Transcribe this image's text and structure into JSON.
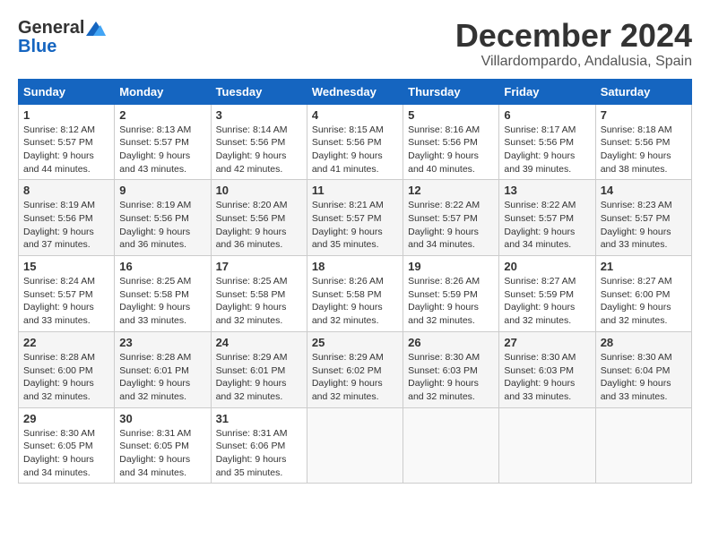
{
  "header": {
    "logo_general": "General",
    "logo_blue": "Blue",
    "month_title": "December 2024",
    "location": "Villardompardo, Andalusia, Spain"
  },
  "days_of_week": [
    "Sunday",
    "Monday",
    "Tuesday",
    "Wednesday",
    "Thursday",
    "Friday",
    "Saturday"
  ],
  "weeks": [
    [
      {
        "day": "1",
        "sunrise": "Sunrise: 8:12 AM",
        "sunset": "Sunset: 5:57 PM",
        "daylight": "Daylight: 9 hours and 44 minutes."
      },
      {
        "day": "2",
        "sunrise": "Sunrise: 8:13 AM",
        "sunset": "Sunset: 5:57 PM",
        "daylight": "Daylight: 9 hours and 43 minutes."
      },
      {
        "day": "3",
        "sunrise": "Sunrise: 8:14 AM",
        "sunset": "Sunset: 5:56 PM",
        "daylight": "Daylight: 9 hours and 42 minutes."
      },
      {
        "day": "4",
        "sunrise": "Sunrise: 8:15 AM",
        "sunset": "Sunset: 5:56 PM",
        "daylight": "Daylight: 9 hours and 41 minutes."
      },
      {
        "day": "5",
        "sunrise": "Sunrise: 8:16 AM",
        "sunset": "Sunset: 5:56 PM",
        "daylight": "Daylight: 9 hours and 40 minutes."
      },
      {
        "day": "6",
        "sunrise": "Sunrise: 8:17 AM",
        "sunset": "Sunset: 5:56 PM",
        "daylight": "Daylight: 9 hours and 39 minutes."
      },
      {
        "day": "7",
        "sunrise": "Sunrise: 8:18 AM",
        "sunset": "Sunset: 5:56 PM",
        "daylight": "Daylight: 9 hours and 38 minutes."
      }
    ],
    [
      {
        "day": "8",
        "sunrise": "Sunrise: 8:19 AM",
        "sunset": "Sunset: 5:56 PM",
        "daylight": "Daylight: 9 hours and 37 minutes."
      },
      {
        "day": "9",
        "sunrise": "Sunrise: 8:19 AM",
        "sunset": "Sunset: 5:56 PM",
        "daylight": "Daylight: 9 hours and 36 minutes."
      },
      {
        "day": "10",
        "sunrise": "Sunrise: 8:20 AM",
        "sunset": "Sunset: 5:56 PM",
        "daylight": "Daylight: 9 hours and 36 minutes."
      },
      {
        "day": "11",
        "sunrise": "Sunrise: 8:21 AM",
        "sunset": "Sunset: 5:57 PM",
        "daylight": "Daylight: 9 hours and 35 minutes."
      },
      {
        "day": "12",
        "sunrise": "Sunrise: 8:22 AM",
        "sunset": "Sunset: 5:57 PM",
        "daylight": "Daylight: 9 hours and 34 minutes."
      },
      {
        "day": "13",
        "sunrise": "Sunrise: 8:22 AM",
        "sunset": "Sunset: 5:57 PM",
        "daylight": "Daylight: 9 hours and 34 minutes."
      },
      {
        "day": "14",
        "sunrise": "Sunrise: 8:23 AM",
        "sunset": "Sunset: 5:57 PM",
        "daylight": "Daylight: 9 hours and 33 minutes."
      }
    ],
    [
      {
        "day": "15",
        "sunrise": "Sunrise: 8:24 AM",
        "sunset": "Sunset: 5:57 PM",
        "daylight": "Daylight: 9 hours and 33 minutes."
      },
      {
        "day": "16",
        "sunrise": "Sunrise: 8:25 AM",
        "sunset": "Sunset: 5:58 PM",
        "daylight": "Daylight: 9 hours and 33 minutes."
      },
      {
        "day": "17",
        "sunrise": "Sunrise: 8:25 AM",
        "sunset": "Sunset: 5:58 PM",
        "daylight": "Daylight: 9 hours and 32 minutes."
      },
      {
        "day": "18",
        "sunrise": "Sunrise: 8:26 AM",
        "sunset": "Sunset: 5:58 PM",
        "daylight": "Daylight: 9 hours and 32 minutes."
      },
      {
        "day": "19",
        "sunrise": "Sunrise: 8:26 AM",
        "sunset": "Sunset: 5:59 PM",
        "daylight": "Daylight: 9 hours and 32 minutes."
      },
      {
        "day": "20",
        "sunrise": "Sunrise: 8:27 AM",
        "sunset": "Sunset: 5:59 PM",
        "daylight": "Daylight: 9 hours and 32 minutes."
      },
      {
        "day": "21",
        "sunrise": "Sunrise: 8:27 AM",
        "sunset": "Sunset: 6:00 PM",
        "daylight": "Daylight: 9 hours and 32 minutes."
      }
    ],
    [
      {
        "day": "22",
        "sunrise": "Sunrise: 8:28 AM",
        "sunset": "Sunset: 6:00 PM",
        "daylight": "Daylight: 9 hours and 32 minutes."
      },
      {
        "day": "23",
        "sunrise": "Sunrise: 8:28 AM",
        "sunset": "Sunset: 6:01 PM",
        "daylight": "Daylight: 9 hours and 32 minutes."
      },
      {
        "day": "24",
        "sunrise": "Sunrise: 8:29 AM",
        "sunset": "Sunset: 6:01 PM",
        "daylight": "Daylight: 9 hours and 32 minutes."
      },
      {
        "day": "25",
        "sunrise": "Sunrise: 8:29 AM",
        "sunset": "Sunset: 6:02 PM",
        "daylight": "Daylight: 9 hours and 32 minutes."
      },
      {
        "day": "26",
        "sunrise": "Sunrise: 8:30 AM",
        "sunset": "Sunset: 6:03 PM",
        "daylight": "Daylight: 9 hours and 32 minutes."
      },
      {
        "day": "27",
        "sunrise": "Sunrise: 8:30 AM",
        "sunset": "Sunset: 6:03 PM",
        "daylight": "Daylight: 9 hours and 33 minutes."
      },
      {
        "day": "28",
        "sunrise": "Sunrise: 8:30 AM",
        "sunset": "Sunset: 6:04 PM",
        "daylight": "Daylight: 9 hours and 33 minutes."
      }
    ],
    [
      {
        "day": "29",
        "sunrise": "Sunrise: 8:30 AM",
        "sunset": "Sunset: 6:05 PM",
        "daylight": "Daylight: 9 hours and 34 minutes."
      },
      {
        "day": "30",
        "sunrise": "Sunrise: 8:31 AM",
        "sunset": "Sunset: 6:05 PM",
        "daylight": "Daylight: 9 hours and 34 minutes."
      },
      {
        "day": "31",
        "sunrise": "Sunrise: 8:31 AM",
        "sunset": "Sunset: 6:06 PM",
        "daylight": "Daylight: 9 hours and 35 minutes."
      },
      null,
      null,
      null,
      null
    ]
  ]
}
